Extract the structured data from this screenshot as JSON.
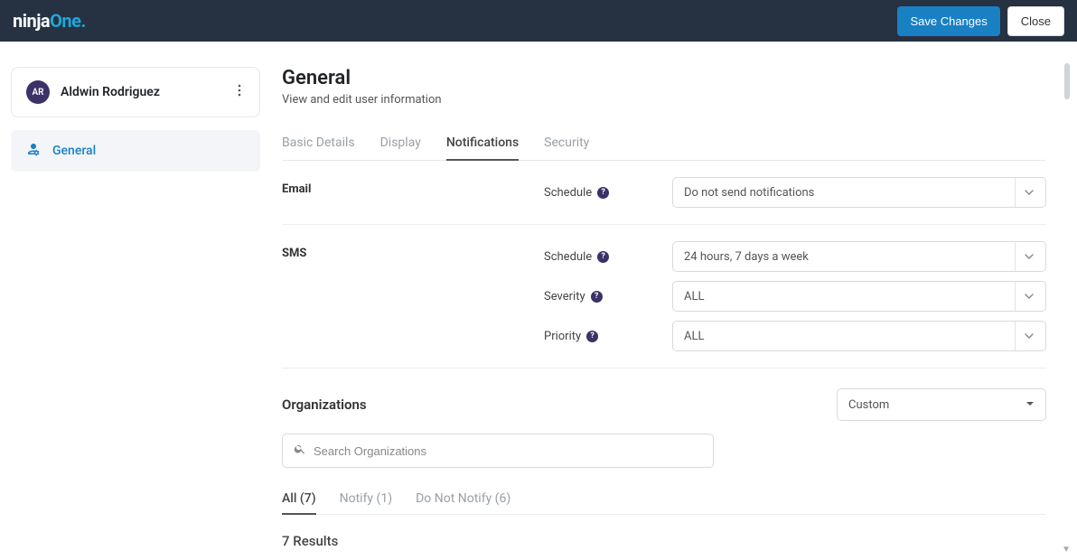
{
  "header": {
    "brand": {
      "prefix": "ninja",
      "suffix": "One",
      "dot": "."
    },
    "save_label": "Save Changes",
    "close_label": "Close"
  },
  "sidebar": {
    "user": {
      "initials": "AR",
      "name": "Aldwin Rodriguez"
    },
    "nav": {
      "general": "General"
    }
  },
  "main": {
    "title": "General",
    "subtitle": "View and edit user information",
    "tabs": {
      "basic": "Basic Details",
      "display": "Display",
      "notifications": "Notifications",
      "security": "Security"
    },
    "email": {
      "label": "Email",
      "schedule_label": "Schedule",
      "schedule_value": "Do not send notifications"
    },
    "sms": {
      "label": "SMS",
      "schedule_label": "Schedule",
      "schedule_value": "24 hours, 7 days a week",
      "severity_label": "Severity",
      "severity_value": "ALL",
      "priority_label": "Priority",
      "priority_value": "ALL"
    },
    "organizations": {
      "title": "Organizations",
      "scope_value": "Custom",
      "search_placeholder": "Search Organizations",
      "filter_tabs": {
        "all": "All (7)",
        "notify": "Notify (1)",
        "not": "Do Not Notify (6)"
      },
      "results": "7 Results"
    }
  }
}
